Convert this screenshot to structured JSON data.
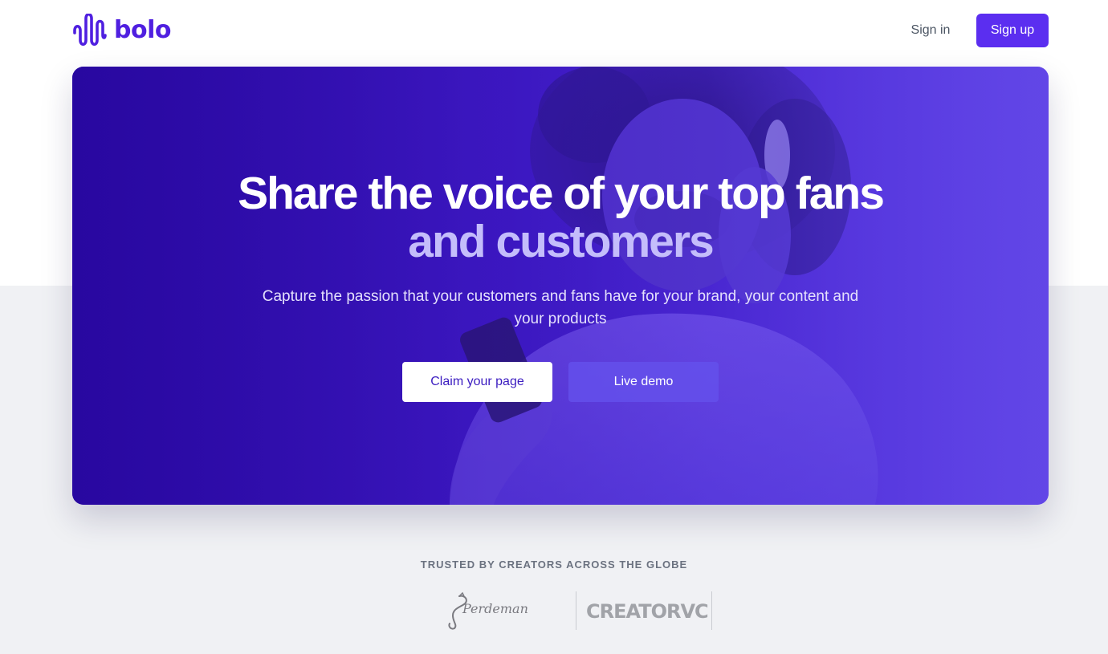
{
  "header": {
    "logo_text": "bolo",
    "signin_label": "Sign in",
    "signup_label": "Sign up"
  },
  "hero": {
    "title_line1": "Share the voice of your top fans",
    "title_line2": "and customers",
    "subtitle": "Capture the passion that your customers and fans have for your brand, your content and your products",
    "claim_label": "Claim your page",
    "demo_label": "Live demo"
  },
  "trusted": {
    "heading": "TRUSTED BY CREATORS ACROSS THE GLOBE",
    "logos": [
      "Perdeman",
      "CREATORVC"
    ]
  },
  "colors": {
    "brand": "#5b2ef0",
    "logo": "#4f1fe0",
    "title_accent": "#c4bdfb"
  }
}
